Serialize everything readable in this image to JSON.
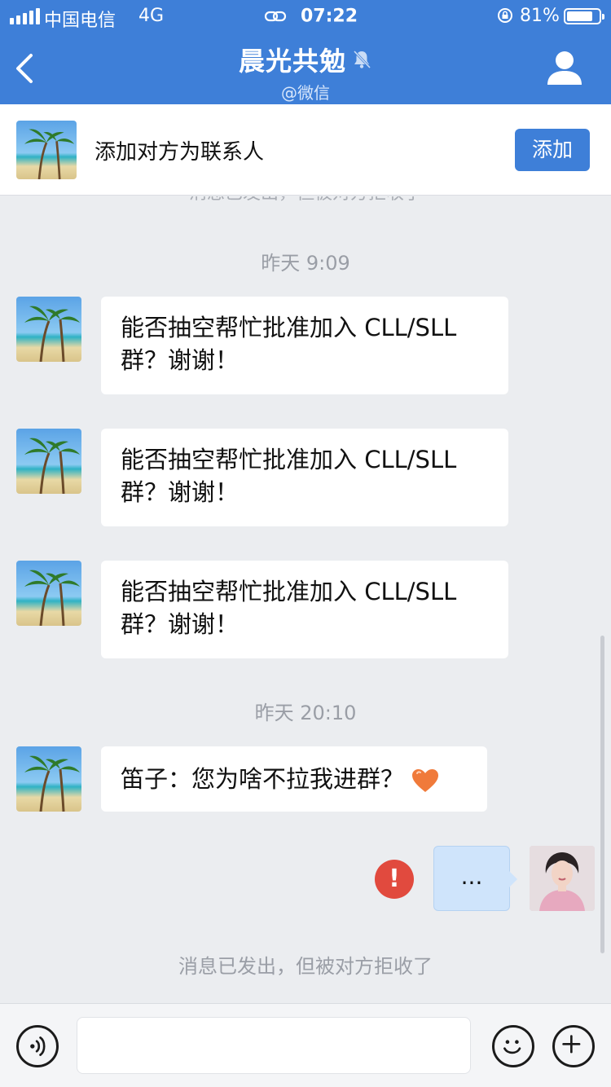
{
  "status_bar": {
    "carrier": "中国电信",
    "network": "4G",
    "time": "07:22",
    "battery_percent": "81%",
    "battery_level": 0.81,
    "icons": [
      "signal-icon",
      "link-icon",
      "rotation-lock-icon",
      "battery-icon"
    ]
  },
  "nav": {
    "title": "晨光共勉",
    "subtitle": "@微信",
    "icons": {
      "back": "chevron-left-icon",
      "mute": "bell-muted-icon",
      "profile": "person-icon"
    }
  },
  "banner": {
    "text": "添加对方为联系人",
    "button": "添加"
  },
  "chat": {
    "cut_system_text": "消息已发出，但被对方拒收了",
    "timestamp_1": "昨天 9:09",
    "messages": [
      {
        "line1": "能否抽空帮忙批准加入 CLL/SLL",
        "line2": "群？谢谢！"
      },
      {
        "line1": "能否抽空帮忙批准加入 CLL/SLL",
        "line2": "群？谢谢！"
      },
      {
        "line1": "能否抽空帮忙批准加入 CLL/SLL",
        "line2": "群？谢谢！"
      }
    ],
    "timestamp_2": "昨天 20:10",
    "message_4": "笛子：您为啥不拉我进群？",
    "message_4_emoji": "heart-emoji",
    "self_message": "...",
    "error_badge": "!",
    "system_bottom": "消息已发出，但被对方拒收了"
  },
  "input_bar": {
    "value": "",
    "icons": {
      "voice": "voice-icon",
      "emoji": "smiley-icon",
      "more": "plus-icon"
    }
  },
  "colors": {
    "brand_blue": "#3e7fd8",
    "chat_bg": "#ebedf0",
    "self_bubble": "#cfe4fb",
    "error_red": "#e14a3e"
  }
}
